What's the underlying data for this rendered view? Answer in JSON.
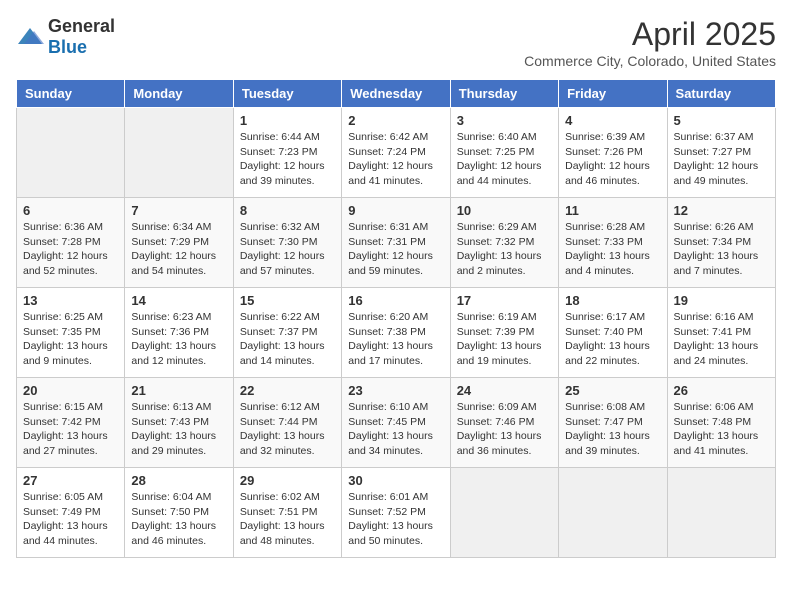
{
  "header": {
    "logo_general": "General",
    "logo_blue": "Blue",
    "month": "April 2025",
    "location": "Commerce City, Colorado, United States"
  },
  "weekdays": [
    "Sunday",
    "Monday",
    "Tuesday",
    "Wednesday",
    "Thursday",
    "Friday",
    "Saturday"
  ],
  "weeks": [
    [
      {
        "day": "",
        "info": ""
      },
      {
        "day": "",
        "info": ""
      },
      {
        "day": "1",
        "info": "Sunrise: 6:44 AM\nSunset: 7:23 PM\nDaylight: 12 hours and 39 minutes."
      },
      {
        "day": "2",
        "info": "Sunrise: 6:42 AM\nSunset: 7:24 PM\nDaylight: 12 hours and 41 minutes."
      },
      {
        "day": "3",
        "info": "Sunrise: 6:40 AM\nSunset: 7:25 PM\nDaylight: 12 hours and 44 minutes."
      },
      {
        "day": "4",
        "info": "Sunrise: 6:39 AM\nSunset: 7:26 PM\nDaylight: 12 hours and 46 minutes."
      },
      {
        "day": "5",
        "info": "Sunrise: 6:37 AM\nSunset: 7:27 PM\nDaylight: 12 hours and 49 minutes."
      }
    ],
    [
      {
        "day": "6",
        "info": "Sunrise: 6:36 AM\nSunset: 7:28 PM\nDaylight: 12 hours and 52 minutes."
      },
      {
        "day": "7",
        "info": "Sunrise: 6:34 AM\nSunset: 7:29 PM\nDaylight: 12 hours and 54 minutes."
      },
      {
        "day": "8",
        "info": "Sunrise: 6:32 AM\nSunset: 7:30 PM\nDaylight: 12 hours and 57 minutes."
      },
      {
        "day": "9",
        "info": "Sunrise: 6:31 AM\nSunset: 7:31 PM\nDaylight: 12 hours and 59 minutes."
      },
      {
        "day": "10",
        "info": "Sunrise: 6:29 AM\nSunset: 7:32 PM\nDaylight: 13 hours and 2 minutes."
      },
      {
        "day": "11",
        "info": "Sunrise: 6:28 AM\nSunset: 7:33 PM\nDaylight: 13 hours and 4 minutes."
      },
      {
        "day": "12",
        "info": "Sunrise: 6:26 AM\nSunset: 7:34 PM\nDaylight: 13 hours and 7 minutes."
      }
    ],
    [
      {
        "day": "13",
        "info": "Sunrise: 6:25 AM\nSunset: 7:35 PM\nDaylight: 13 hours and 9 minutes."
      },
      {
        "day": "14",
        "info": "Sunrise: 6:23 AM\nSunset: 7:36 PM\nDaylight: 13 hours and 12 minutes."
      },
      {
        "day": "15",
        "info": "Sunrise: 6:22 AM\nSunset: 7:37 PM\nDaylight: 13 hours and 14 minutes."
      },
      {
        "day": "16",
        "info": "Sunrise: 6:20 AM\nSunset: 7:38 PM\nDaylight: 13 hours and 17 minutes."
      },
      {
        "day": "17",
        "info": "Sunrise: 6:19 AM\nSunset: 7:39 PM\nDaylight: 13 hours and 19 minutes."
      },
      {
        "day": "18",
        "info": "Sunrise: 6:17 AM\nSunset: 7:40 PM\nDaylight: 13 hours and 22 minutes."
      },
      {
        "day": "19",
        "info": "Sunrise: 6:16 AM\nSunset: 7:41 PM\nDaylight: 13 hours and 24 minutes."
      }
    ],
    [
      {
        "day": "20",
        "info": "Sunrise: 6:15 AM\nSunset: 7:42 PM\nDaylight: 13 hours and 27 minutes."
      },
      {
        "day": "21",
        "info": "Sunrise: 6:13 AM\nSunset: 7:43 PM\nDaylight: 13 hours and 29 minutes."
      },
      {
        "day": "22",
        "info": "Sunrise: 6:12 AM\nSunset: 7:44 PM\nDaylight: 13 hours and 32 minutes."
      },
      {
        "day": "23",
        "info": "Sunrise: 6:10 AM\nSunset: 7:45 PM\nDaylight: 13 hours and 34 minutes."
      },
      {
        "day": "24",
        "info": "Sunrise: 6:09 AM\nSunset: 7:46 PM\nDaylight: 13 hours and 36 minutes."
      },
      {
        "day": "25",
        "info": "Sunrise: 6:08 AM\nSunset: 7:47 PM\nDaylight: 13 hours and 39 minutes."
      },
      {
        "day": "26",
        "info": "Sunrise: 6:06 AM\nSunset: 7:48 PM\nDaylight: 13 hours and 41 minutes."
      }
    ],
    [
      {
        "day": "27",
        "info": "Sunrise: 6:05 AM\nSunset: 7:49 PM\nDaylight: 13 hours and 44 minutes."
      },
      {
        "day": "28",
        "info": "Sunrise: 6:04 AM\nSunset: 7:50 PM\nDaylight: 13 hours and 46 minutes."
      },
      {
        "day": "29",
        "info": "Sunrise: 6:02 AM\nSunset: 7:51 PM\nDaylight: 13 hours and 48 minutes."
      },
      {
        "day": "30",
        "info": "Sunrise: 6:01 AM\nSunset: 7:52 PM\nDaylight: 13 hours and 50 minutes."
      },
      {
        "day": "",
        "info": ""
      },
      {
        "day": "",
        "info": ""
      },
      {
        "day": "",
        "info": ""
      }
    ]
  ]
}
